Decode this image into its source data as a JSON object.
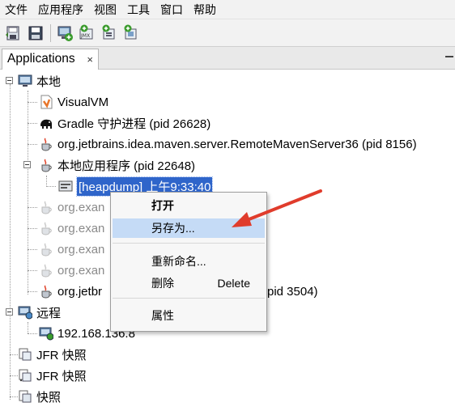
{
  "menubar": {
    "items": [
      "文件",
      "应用程序",
      "视图",
      "工具",
      "窗口",
      "帮助"
    ]
  },
  "toolbar": {
    "buttons": [
      "load-icon",
      "save-icon",
      "add-host-icon",
      "add-jmx-icon",
      "add-core-dump-icon",
      "add-snapshot-icon"
    ]
  },
  "tab": {
    "label": "Applications",
    "close": "×"
  },
  "tree": {
    "local": "本地",
    "visualvm": "VisualVM",
    "gradle": "Gradle 守护进程 (pid 26628)",
    "maven": "org.jetbrains.idea.maven.server.RemoteMavenServer36 (pid 8156)",
    "localapp": "本地应用程序 (pid 22648)",
    "heapdump": "[heapdump] 上午9:33:40",
    "org1": "org.exan",
    "org2": "org.exan",
    "org3": "org.exan",
    "org4": "org.exan",
    "jetbrains_left": "org.jetbr",
    "jetbrains_right": "pid 3504)",
    "remote": "远程",
    "ip": "192.168.136.8",
    "jfr1": "JFR 快照",
    "jfr2": "JFR 快照",
    "snapshot": "快照"
  },
  "context_menu": {
    "open": "打开",
    "save_as": "另存为...",
    "rename": "重新命名...",
    "delete": "删除",
    "delete_shortcut": "Delete",
    "properties": "属性"
  },
  "colors": {
    "selection": "#2f65ca",
    "menu_highlight": "#c5dbf6",
    "arrow": "#e03c2c"
  }
}
